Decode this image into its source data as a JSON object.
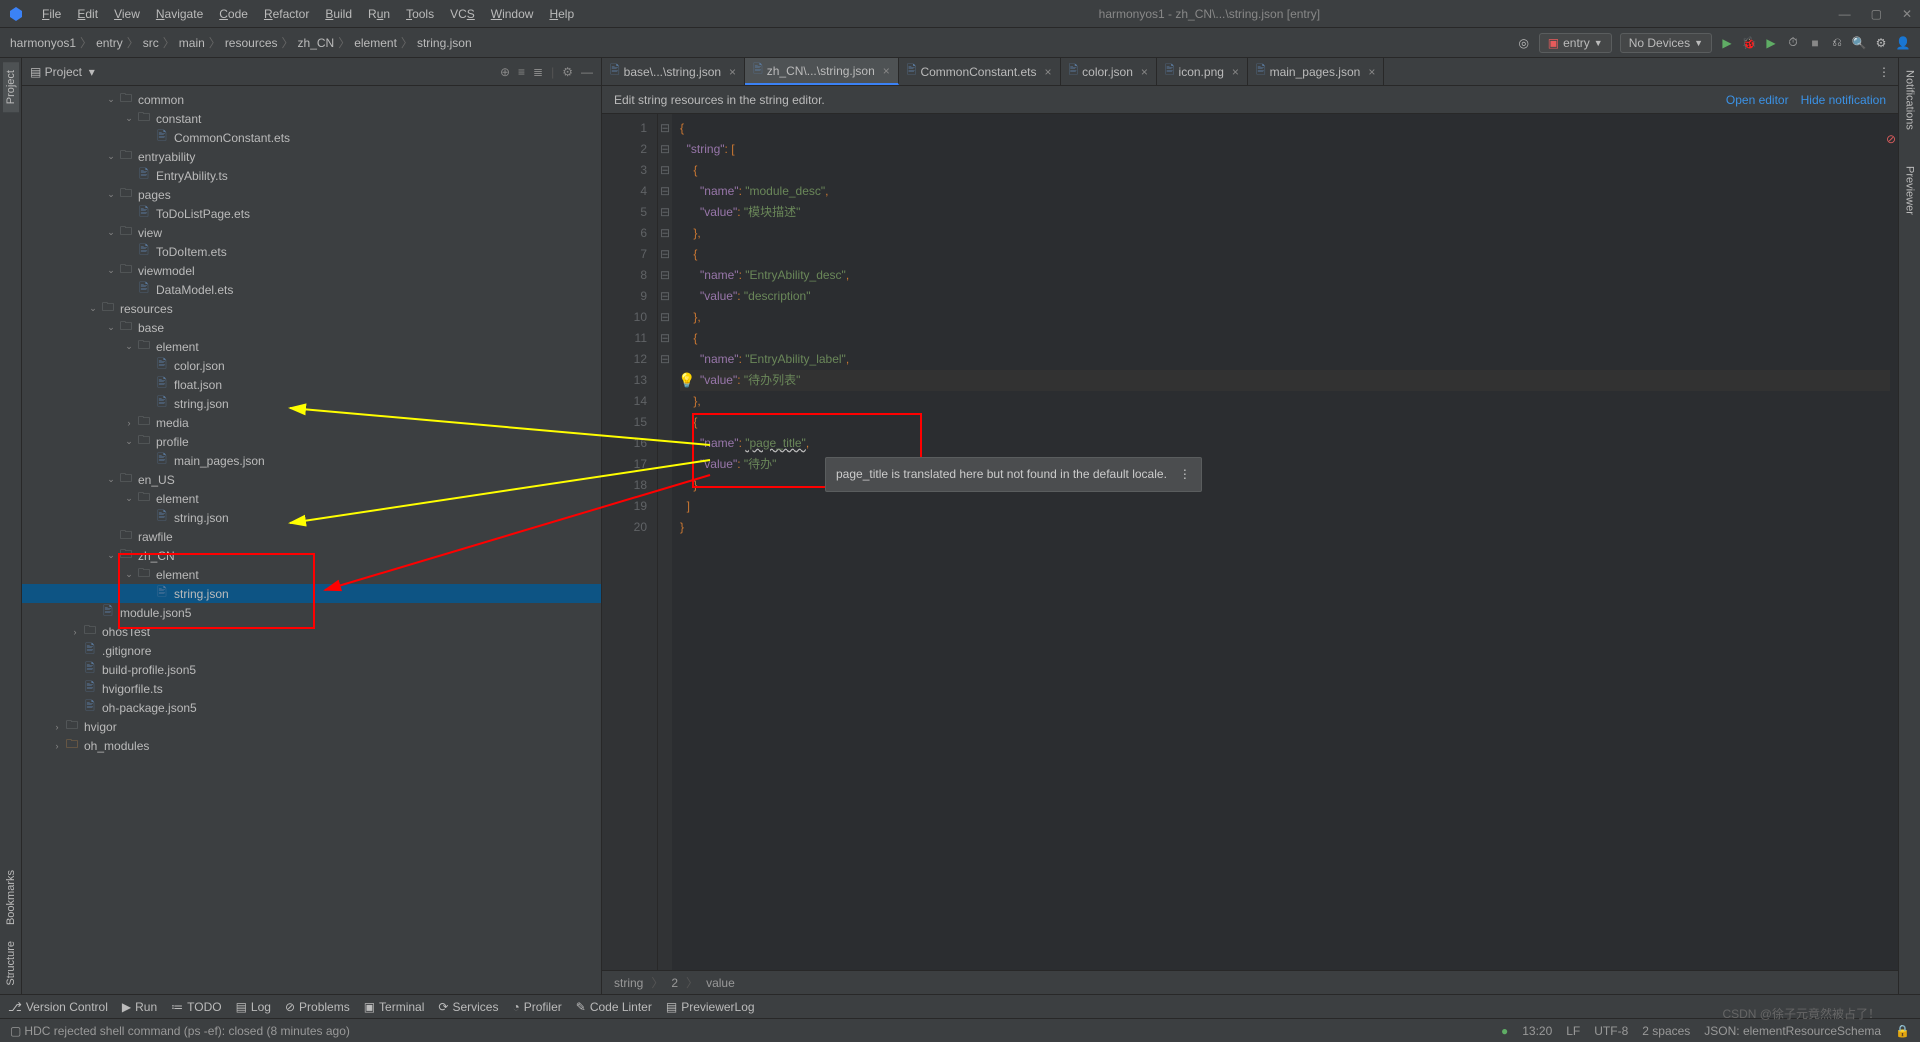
{
  "window": {
    "title": "harmonyos1 - zh_CN\\...\\string.json [entry]"
  },
  "menu": {
    "file": "File",
    "edit": "Edit",
    "view": "View",
    "navigate": "Navigate",
    "code": "Code",
    "refactor": "Refactor",
    "build": "Build",
    "run": "Run",
    "tools": "Tools",
    "vcs": "VCS",
    "window": "Window",
    "help": "Help"
  },
  "breadcrumb": [
    "harmonyos1",
    "entry",
    "src",
    "main",
    "resources",
    "zh_CN",
    "element",
    "string.json"
  ],
  "navRight": {
    "config": "entry",
    "device": "No Devices"
  },
  "projectPanel": {
    "title": "Project"
  },
  "tree": [
    {
      "d": 4,
      "a": "v",
      "t": "folder",
      "n": "common"
    },
    {
      "d": 5,
      "a": "v",
      "t": "folder",
      "n": "constant"
    },
    {
      "d": 6,
      "a": "",
      "t": "file",
      "n": "CommonConstant.ets"
    },
    {
      "d": 4,
      "a": "v",
      "t": "folder",
      "n": "entryability"
    },
    {
      "d": 5,
      "a": "",
      "t": "file",
      "n": "EntryAbility.ts"
    },
    {
      "d": 4,
      "a": "v",
      "t": "folder",
      "n": "pages"
    },
    {
      "d": 5,
      "a": "",
      "t": "file",
      "n": "ToDoListPage.ets"
    },
    {
      "d": 4,
      "a": "v",
      "t": "folder",
      "n": "view"
    },
    {
      "d": 5,
      "a": "",
      "t": "file",
      "n": "ToDoItem.ets"
    },
    {
      "d": 4,
      "a": "v",
      "t": "folder",
      "n": "viewmodel"
    },
    {
      "d": 5,
      "a": "",
      "t": "file",
      "n": "DataModel.ets"
    },
    {
      "d": 3,
      "a": "v",
      "t": "folder",
      "n": "resources"
    },
    {
      "d": 4,
      "a": "v",
      "t": "folder",
      "n": "base"
    },
    {
      "d": 5,
      "a": "v",
      "t": "folder",
      "n": "element"
    },
    {
      "d": 6,
      "a": "",
      "t": "file",
      "n": "color.json"
    },
    {
      "d": 6,
      "a": "",
      "t": "file",
      "n": "float.json"
    },
    {
      "d": 6,
      "a": "",
      "t": "file",
      "n": "string.json"
    },
    {
      "d": 5,
      "a": ">",
      "t": "folder",
      "n": "media"
    },
    {
      "d": 5,
      "a": "v",
      "t": "folder",
      "n": "profile"
    },
    {
      "d": 6,
      "a": "",
      "t": "file",
      "n": "main_pages.json"
    },
    {
      "d": 4,
      "a": "v",
      "t": "folder",
      "n": "en_US"
    },
    {
      "d": 5,
      "a": "v",
      "t": "folder",
      "n": "element"
    },
    {
      "d": 6,
      "a": "",
      "t": "file",
      "n": "string.json"
    },
    {
      "d": 4,
      "a": "",
      "t": "folder",
      "n": "rawfile"
    },
    {
      "d": 4,
      "a": "v",
      "t": "folder",
      "n": "zh_CN"
    },
    {
      "d": 5,
      "a": "v",
      "t": "folder",
      "n": "element"
    },
    {
      "d": 6,
      "a": "",
      "t": "file",
      "n": "string.json",
      "sel": true
    },
    {
      "d": 3,
      "a": "",
      "t": "file",
      "n": "module.json5"
    },
    {
      "d": 2,
      "a": ">",
      "t": "folder",
      "n": "ohosTest"
    },
    {
      "d": 2,
      "a": "",
      "t": "file",
      "n": ".gitignore"
    },
    {
      "d": 2,
      "a": "",
      "t": "file",
      "n": "build-profile.json5"
    },
    {
      "d": 2,
      "a": "",
      "t": "file",
      "n": "hvigorfile.ts"
    },
    {
      "d": 2,
      "a": "",
      "t": "file",
      "n": "oh-package.json5"
    },
    {
      "d": 1,
      "a": ">",
      "t": "folder",
      "n": "hvigor"
    },
    {
      "d": 1,
      "a": ">",
      "t": "lib",
      "n": "oh_modules"
    }
  ],
  "tabs": [
    {
      "label": "base\\...\\string.json",
      "active": false
    },
    {
      "label": "zh_CN\\...\\string.json",
      "active": true
    },
    {
      "label": "CommonConstant.ets",
      "active": false
    },
    {
      "label": "color.json",
      "active": false
    },
    {
      "label": "icon.png",
      "active": false
    },
    {
      "label": "main_pages.json",
      "active": false
    }
  ],
  "banner": {
    "text": "Edit string resources in the string editor.",
    "open": "Open editor",
    "hide": "Hide notification"
  },
  "code": {
    "lines": 20,
    "tooltip": "page_title is translated here but not found in the default locale.",
    "errCount": "1"
  },
  "editorCrumb": [
    "string",
    "2",
    "value"
  ],
  "bottomTools": {
    "vcs": "Version Control",
    "run": "Run",
    "todo": "TODO",
    "log": "Log",
    "problems": "Problems",
    "terminal": "Terminal",
    "services": "Services",
    "profiler": "Profiler",
    "linter": "Code Linter",
    "preview": "PreviewerLog"
  },
  "status": {
    "msg": "HDC rejected shell command (ps -ef): closed (8 minutes ago)",
    "pos": "13:20",
    "sep": "LF",
    "enc": "UTF-8",
    "indent": "2 spaces",
    "schema": "JSON: elementResourceSchema"
  },
  "sideLeft": {
    "project": "Project",
    "bookmarks": "Bookmarks",
    "structure": "Structure"
  },
  "sideRight": {
    "notifications": "Notifications",
    "previewer": "Previewer"
  },
  "watermark": "CSDN @徐子元竟然被占了！"
}
